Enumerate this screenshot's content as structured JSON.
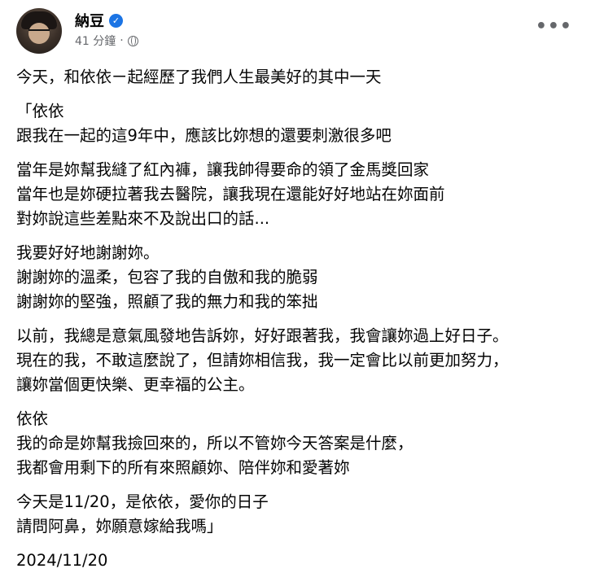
{
  "header": {
    "name": "納豆",
    "time": "41 分鐘",
    "separator": "·"
  },
  "icons": {
    "verified": "verified-badge-icon",
    "audience": "globe-icon",
    "more": "more-options-icon"
  },
  "colors": {
    "verified": "#1b74e4",
    "meta_text": "#65676b",
    "body_text": "#050505"
  },
  "more_label": "•••",
  "paragraphs": [
    [
      "今天，和依依ㄧ起經歷了我們人生最美好的其中一天"
    ],
    [
      "「依依",
      "跟我在一起的這9年中，應該比妳想的還要刺激很多吧"
    ],
    [
      "當年是妳幫我縫了紅內褲，讓我帥得要命的領了金馬獎回家",
      "當年也是妳硬拉著我去醫院，讓我現在還能好好地站在妳面前",
      "對妳說這些差點來不及說出口的話..."
    ],
    [
      "我要好好地謝謝妳。",
      "謝謝妳的溫柔，包容了我的自傲和我的脆弱",
      "謝謝妳的堅強，照顧了我的無力和我的笨拙"
    ],
    [
      "以前，我總是意氣風發地告訴妳，好好跟著我，我會讓妳過上好日子。",
      "現在的我，不敢這麼說了，但請妳相信我，我一定會比以前更加努力，",
      "讓妳當個更快樂、更幸福的公主。"
    ],
    [
      "依依",
      "我的命是妳幫我撿回來的，所以不管妳今天答案是什麼，",
      "我都會用剩下的所有來照顧妳、陪伴妳和愛著妳"
    ],
    [
      "今天是11/20，是依依，愛你的日子",
      "請問阿鼻，妳願意嫁給我嗎」"
    ]
  ],
  "date": "2024/11/20"
}
